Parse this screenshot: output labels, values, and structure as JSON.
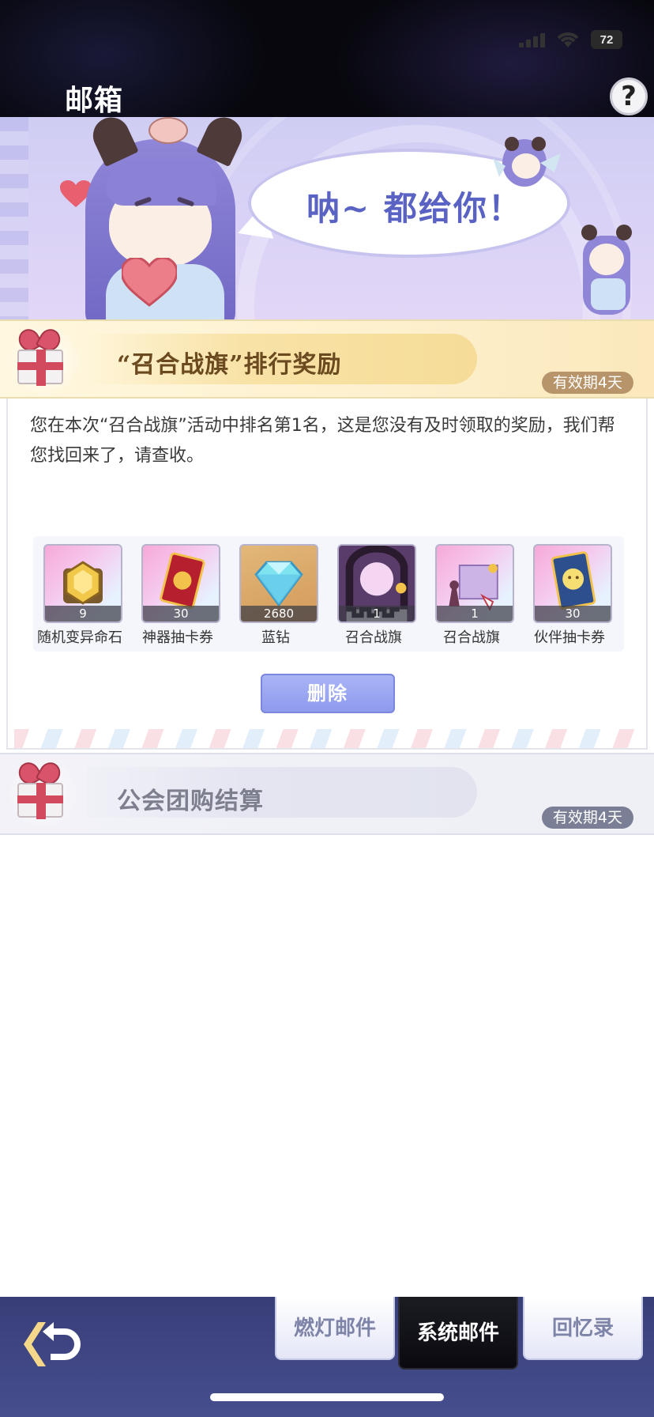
{
  "status_bar": {
    "battery": "72"
  },
  "header": {
    "title": "邮箱",
    "help_label": "?"
  },
  "banner": {
    "speech": "呐~ 都给你！"
  },
  "mails": [
    {
      "title": "“召合战旗”排行奖励",
      "validity": "有效期4天",
      "body": "您在本次“召合战旗”活动中排名第1名，这是您没有及时领取的奖励，我们帮您找回来了，请查收。",
      "rewards": [
        {
          "label": "随机变异命石",
          "count": "9",
          "icon": "mutant-stone-icon"
        },
        {
          "label": "神器抽卡券",
          "count": "30",
          "icon": "artifact-card-icon"
        },
        {
          "label": "蓝钻",
          "count": "2680",
          "icon": "blue-diamond-icon"
        },
        {
          "label": "召合战旗",
          "count": "1",
          "icon": "banner-frame-icon"
        },
        {
          "label": "召合战旗",
          "count": "1",
          "icon": "banner-chess-icon"
        },
        {
          "label": "伙伴抽卡券",
          "count": "30",
          "icon": "partner-card-icon"
        }
      ],
      "delete_label": "删除"
    },
    {
      "title": "公会团购结算",
      "validity": "有效期4天"
    }
  ],
  "bottom_nav": {
    "tabs": [
      {
        "label": "燃灯邮件",
        "active": false
      },
      {
        "label": "系统邮件",
        "active": true
      },
      {
        "label": "回忆录",
        "active": false
      }
    ]
  },
  "colors": {
    "accent_purple": "#8e9aee",
    "gold_header": "#fbe8bc",
    "nav_bg": "#3f4684",
    "validity_gold": "#b8946a",
    "validity_grey": "#7a7f96"
  }
}
